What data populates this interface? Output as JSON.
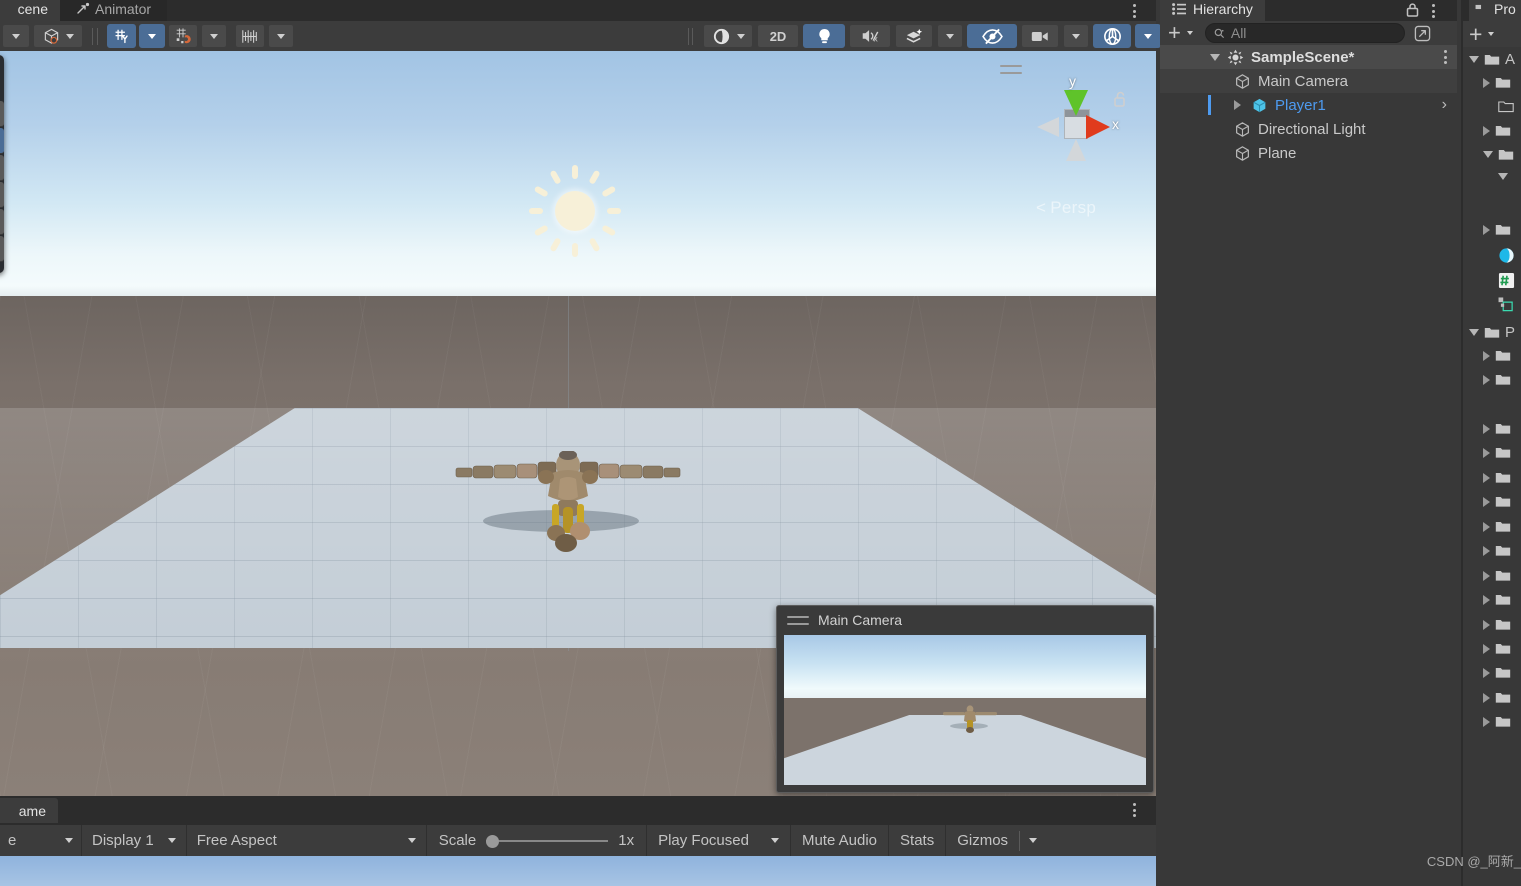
{
  "app": "Unity Editor",
  "scene_panel": {
    "tabs": [
      {
        "label": "cene",
        "icon": "scene-icon",
        "active": true
      },
      {
        "label": "Animator",
        "icon": "animator-icon",
        "active": false
      }
    ],
    "overflow_menu": "kebab-menu",
    "toolbar_left": [
      {
        "name": "draw-mode-dropdown",
        "glyph": "▾"
      },
      {
        "name": "shading-mode-dropdown",
        "glyph": "cube-o-icon"
      },
      {
        "name": "gizmo-toggle-2d",
        "glyph": "grid-y-icon",
        "on": true
      },
      {
        "name": "gizmo-toggle-dropdown",
        "glyph": "▾",
        "on": true
      },
      {
        "name": "snap-increment",
        "glyph": "snap-magnet-icon"
      },
      {
        "name": "snap-dropdown",
        "glyph": "▾"
      },
      {
        "name": "grid-size",
        "glyph": "grid-ruler-icon"
      },
      {
        "name": "grid-dropdown",
        "glyph": "▾"
      }
    ],
    "toolbar_right": [
      {
        "name": "scene-view-mode",
        "glyph": "sphere-icon",
        "on": false
      },
      {
        "name": "toggle-2d",
        "glyph": "2D",
        "on": false
      },
      {
        "name": "toggle-scene-lighting",
        "glyph": "lightbulb-icon",
        "on": true
      },
      {
        "name": "toggle-audio",
        "glyph": "mute-audio-icon",
        "on": false
      },
      {
        "name": "fx-effects",
        "glyph": "fx-icon",
        "on": false
      },
      {
        "name": "fx-dropdown",
        "glyph": "▾",
        "on": false
      },
      {
        "name": "scene-visibility",
        "glyph": "eye-off-icon",
        "on": true
      },
      {
        "name": "camera-settings",
        "glyph": "camera-icon",
        "on": false
      },
      {
        "name": "camera-dropdown",
        "glyph": "▾",
        "on": false
      },
      {
        "name": "gizmos-toggle",
        "glyph": "gizmo-globe-icon",
        "on": true
      },
      {
        "name": "gizmos-dropdown",
        "glyph": "▾",
        "on": true
      }
    ],
    "view_gizmo": {
      "axis_y": "y",
      "axis_x": "x",
      "projection": "Persp",
      "lock": "unlocked-icon"
    },
    "camera_preview": {
      "title": "Main Camera"
    }
  },
  "hierarchy": {
    "tab_label": "Hierarchy",
    "tab_icon": "hierarchy-icon",
    "lock_icon": "lock-icon",
    "overflow_menu": "kebab-menu",
    "add_label": "+",
    "search": {
      "placeholder": "All",
      "value": ""
    },
    "search_icon": "search-icon",
    "expand_icon": "open-in-new-icon",
    "tree": [
      {
        "label": "SampleScene*",
        "icon": "scene-asset-icon",
        "depth": 0,
        "expanded": true,
        "selected": false,
        "bold": true
      },
      {
        "label": "Main Camera",
        "icon": "gameobject-icon",
        "depth": 1,
        "expanded": null,
        "selected": false,
        "bold": false
      },
      {
        "label": "Player1",
        "icon": "prefab-icon",
        "depth": 1,
        "expanded": false,
        "selected": true,
        "bold": false
      },
      {
        "label": "Directional Light",
        "icon": "gameobject-icon",
        "depth": 1,
        "expanded": null,
        "selected": false,
        "bold": false
      },
      {
        "label": "Plane",
        "icon": "gameobject-icon",
        "depth": 1,
        "expanded": null,
        "selected": false,
        "bold": false
      }
    ]
  },
  "project": {
    "tab_label": "Pro",
    "tab_icon": "project-icon",
    "add_label": "+",
    "rows": [
      {
        "icon": "folder-open-icon",
        "label": "A",
        "arrow": "down",
        "depth": 0
      },
      {
        "icon": "folder-icon",
        "label": "",
        "arrow": "right",
        "depth": 1
      },
      {
        "icon": "folder-outline-icon",
        "label": "",
        "arrow": "none",
        "depth": 1
      },
      {
        "icon": "folder-icon",
        "label": "",
        "arrow": "right",
        "depth": 1
      },
      {
        "icon": "folder-icon",
        "label": "",
        "arrow": "down",
        "depth": 1
      },
      {
        "icon": "none",
        "label": "",
        "arrow": "down",
        "depth": 2
      },
      {
        "icon": "none",
        "label": "",
        "arrow": "none",
        "depth": 2
      },
      {
        "icon": "folder-icon",
        "label": "",
        "arrow": "right",
        "depth": 1
      },
      {
        "icon": "material-sphere-icon",
        "label": "",
        "arrow": "none",
        "depth": 1
      },
      {
        "icon": "csharp-script-icon",
        "label": "",
        "arrow": "none",
        "depth": 1
      },
      {
        "icon": "prefab-asset-icon",
        "label": "",
        "arrow": "none",
        "depth": 1
      },
      {
        "icon": "folder-open-icon",
        "label": "P",
        "arrow": "down",
        "depth": 0
      },
      {
        "icon": "folder-icon",
        "label": "",
        "arrow": "right",
        "depth": 1
      },
      {
        "icon": "folder-icon",
        "label": "",
        "arrow": "right",
        "depth": 1
      },
      {
        "icon": "folder-icon",
        "label": "",
        "arrow": "right",
        "depth": 1
      },
      {
        "icon": "folder-icon",
        "label": "",
        "arrow": "right",
        "depth": 1
      },
      {
        "icon": "folder-icon",
        "label": "",
        "arrow": "right",
        "depth": 1
      },
      {
        "icon": "folder-icon",
        "label": "",
        "arrow": "right",
        "depth": 1
      },
      {
        "icon": "folder-icon",
        "label": "",
        "arrow": "right",
        "depth": 1
      },
      {
        "icon": "folder-icon",
        "label": "",
        "arrow": "right",
        "depth": 1
      },
      {
        "icon": "folder-icon",
        "label": "",
        "arrow": "right",
        "depth": 1
      },
      {
        "icon": "folder-icon",
        "label": "",
        "arrow": "right",
        "depth": 1
      }
    ]
  },
  "game_panel": {
    "tab_label": "ame",
    "overflow_menu": "kebab-menu",
    "toolbar": {
      "left_cut_dropdown": "e",
      "display": "Display 1",
      "aspect": "Free Aspect",
      "scale_label": "Scale",
      "scale_value": "1x",
      "scale_fraction": 0.06,
      "play_mode": "Play Focused",
      "mute_audio": "Mute Audio",
      "stats": "Stats",
      "gizmos": "Gizmos",
      "gizmos_dropdown": "▾"
    }
  },
  "watermark": "CSDN @_阿新_",
  "colors": {
    "accent_blue": "#4b6d96",
    "selection_text": "#4e9bf0",
    "panel_bg": "#383838",
    "toolbar_bg": "#3c3c3c",
    "tab_bg": "#2c2c2c"
  }
}
